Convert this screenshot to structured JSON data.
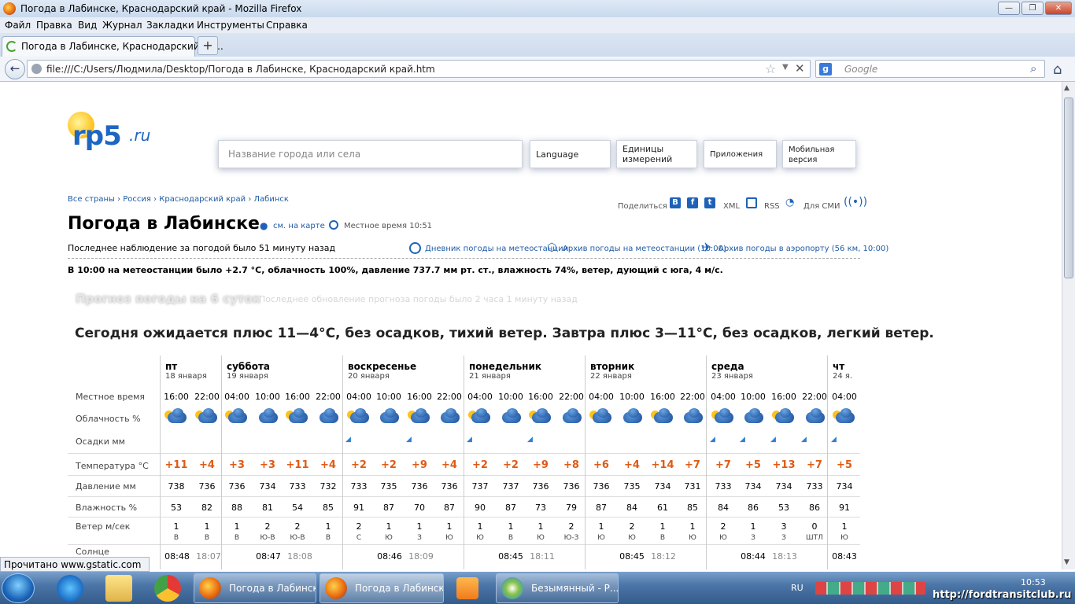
{
  "window": {
    "title": "Погода в Лабинске, Краснодарский край - Mozilla Firefox"
  },
  "menu": [
    "Файл",
    "Правка",
    "Вид",
    "Журнал",
    "Закладки",
    "Инструменты",
    "Справка"
  ],
  "tab": {
    "title": "Погода в Лабинске, Краснодарский кр..."
  },
  "nav": {
    "url": "file:///C:/Users/Людмила/Desktop/Погода в Лабинске, Краснодарский край.htm",
    "search_placeholder": "Google"
  },
  "site": {
    "logo_main": "rp5",
    "logo_suffix": ".ru",
    "search_placeholder": "Название города или села",
    "top_buttons": [
      "Language",
      "Единицы измерений",
      "Приложения",
      "Мобильная версия"
    ],
    "breadcrumbs": "Все страны › Россия › Краснодарский край › Лабинск",
    "share_label": "Поделиться",
    "share_xml": "XML",
    "share_rss": "RSS",
    "share_smi": "Для СМИ",
    "title": "Погода в Лабинске",
    "map_link": "см. на карте",
    "local_time": "Местное время  10:51",
    "last_obs": "Последнее наблюдение за погодой было 51 минуту назад",
    "link_diary": "Дневник погоды на метеостанции",
    "link_archive": "Архив погоды на метеостанции (10:00)",
    "link_airport": "Архив погоды в аэропорту (56 км, 10:00)",
    "observation": "В 10:00 на метеостанции было +2.7 °C, облачность 100%, давление 737.7 мм рт. ст., влажность 74%, ветер, дующий с юга, 4 м/с.",
    "forecast_title": "Прогноз погоды на 6 суток",
    "forecast_update": "Последнее обновление прогноза погоды было 2 часа 1 минуту назад",
    "summary": "Сегодня ожидается плюс 11—4°С, без осадков, тихий ветер. Завтра плюс 3—11°С, без осадков, легкий ветер."
  },
  "table": {
    "row_labels": [
      "Местное время",
      "Облачность %",
      "Осадки мм",
      "Температура °C",
      "Давление мм",
      "Влажность %",
      "Ветер м/сек",
      "Солнце"
    ],
    "days": [
      {
        "name": "пт",
        "date": "18 января"
      },
      {
        "name": "суббота",
        "date": "19 января"
      },
      {
        "name": "воскресенье",
        "date": "20 января"
      },
      {
        "name": "понедельник",
        "date": "21 января"
      },
      {
        "name": "вторник",
        "date": "22 января"
      },
      {
        "name": "среда",
        "date": "23 января"
      },
      {
        "name": "чт",
        "date": "24 я."
      }
    ],
    "times": [
      "16:00",
      "22:00",
      "04:00",
      "10:00",
      "16:00",
      "22:00",
      "04:00",
      "10:00",
      "16:00",
      "22:00",
      "04:00",
      "10:00",
      "16:00",
      "22:00",
      "04:00",
      "10:00",
      "16:00",
      "22:00",
      "04:00",
      "10:00",
      "16:00",
      "22:00",
      "04:00"
    ],
    "temps": [
      "+11",
      "+4",
      "+3",
      "+3",
      "+11",
      "+4",
      "+2",
      "+2",
      "+9",
      "+4",
      "+2",
      "+2",
      "+9",
      "+8",
      "+6",
      "+4",
      "+14",
      "+7",
      "+7",
      "+5",
      "+13",
      "+7",
      "+5"
    ],
    "pressure": [
      "738",
      "736",
      "736",
      "734",
      "733",
      "732",
      "733",
      "735",
      "736",
      "736",
      "737",
      "737",
      "736",
      "736",
      "736",
      "735",
      "734",
      "731",
      "733",
      "734",
      "734",
      "733",
      "734"
    ],
    "humidity": [
      "53",
      "82",
      "88",
      "81",
      "54",
      "85",
      "91",
      "87",
      "70",
      "87",
      "90",
      "87",
      "73",
      "79",
      "87",
      "84",
      "61",
      "85",
      "84",
      "86",
      "53",
      "86",
      "91"
    ],
    "wind": [
      "1",
      "1",
      "1",
      "2",
      "2",
      "1",
      "2",
      "1",
      "1",
      "1",
      "1",
      "1",
      "1",
      "2",
      "1",
      "2",
      "1",
      "1",
      "2",
      "1",
      "3",
      "0",
      "1"
    ],
    "wind_dir": [
      "В",
      "В",
      "В",
      "Ю-В",
      "Ю-В",
      "В",
      "С",
      "Ю",
      "З",
      "Ю",
      "Ю",
      "В",
      "Ю",
      "Ю-З",
      "Ю",
      "Ю",
      "В",
      "Ю",
      "Ю",
      "З",
      "З",
      "ШТЛ",
      "Ю"
    ],
    "sun": [
      "08:48",
      "18:07",
      "08:47",
      "18:08",
      "08:46",
      "18:09",
      "08:45",
      "18:11",
      "08:45",
      "18:12",
      "08:44",
      "18:13",
      "08:43"
    ]
  },
  "status": "Прочитано www.gstatic.com",
  "taskbar": {
    "items": [
      "Погода в Лабинске...",
      "Погода в Лабинске...",
      "Безымянный - Р..."
    ],
    "lang": "RU",
    "time": "10:53",
    "url": "http://fordtransitclub.ru"
  }
}
